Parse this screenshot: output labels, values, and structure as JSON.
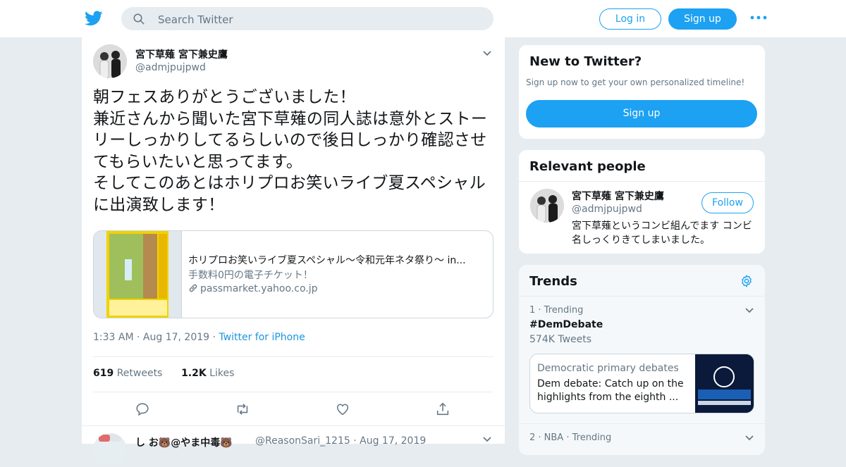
{
  "topbar": {
    "search_placeholder": "Search Twitter",
    "login_label": "Log in",
    "signup_label": "Sign up"
  },
  "tweet": {
    "name": "宮下草薙 宮下兼史鷹",
    "handle": "@admjpujpwd",
    "text": "朝フェスありがとうございました！\n兼近さんから聞いた宮下草薙の同人誌は意外とストーリーしっかりしてるらしいので後日しっかり確認させてもらいたいと思ってます。\nそしてこのあとはホリプロお笑いライブ夏スペシャルに出演致します！",
    "card": {
      "title": "ホリプロお笑いライブ夏スペシャル～令和元年ネタ祭り～ in...",
      "description": "手数料0円の電子チケット！",
      "domain": "passmarket.yahoo.co.jp"
    },
    "time": "1:33 AM",
    "date": "Aug 17, 2019",
    "source": "Twitter for iPhone",
    "retweets_count": "619",
    "retweets_label": "Retweets",
    "likes_count": "1.2K",
    "likes_label": "Likes"
  },
  "next_tweet": {
    "name": "し お🐻@やま中毒🐻",
    "handle": "@ReasonSari_1215",
    "date": "Aug 17, 2019"
  },
  "new_to_twitter": {
    "title": "New to Twitter?",
    "subtitle": "Sign up now to get your own personalized timeline!",
    "signup_label": "Sign up"
  },
  "relevant_people": {
    "title": "Relevant people",
    "name": "宮下草薙 宮下兼史鷹",
    "handle": "@admjpujpwd",
    "follow_label": "Follow",
    "bio": "宮下草薙というコンビ組んでます コンビ名しっくりきてしまいました。"
  },
  "trends": {
    "title": "Trends",
    "items": [
      {
        "rank": "1 · Trending",
        "name": "#DemDebate",
        "count": "574K Tweets"
      },
      {
        "rank": "2 · NBA · Trending"
      }
    ],
    "news": {
      "source": "Democratic primary debates",
      "headline": "Dem debate: Catch up on the highlights from the eighth ..."
    }
  },
  "colors": {
    "accent": "#1da1f2",
    "link": "#1b95e0",
    "muted": "#657786",
    "background": "#e6ecf0"
  }
}
